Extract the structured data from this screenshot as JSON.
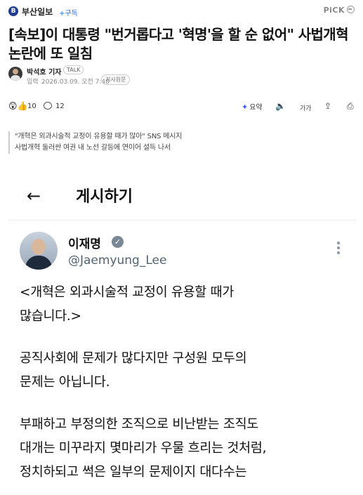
{
  "press": {
    "logo_letter": "B",
    "name": "부산일보",
    "subscribe_label": "+구독",
    "pick_label": "PiCK"
  },
  "article": {
    "headline": "[속보]이 대통령 \"번거롭다고 '혁명'을 할 순 없어\" 사법개혁 논란에 또 일침",
    "author": "박석호 기자",
    "talk_label": "TALK",
    "date_label": "입력",
    "date": "2026.03.09. 오전 7:48",
    "original_label": "기사원문",
    "subtitle_lines": [
      "\"개혁은 외과시술적 교정이 유용할 때가 많아\" SNS 메시지",
      "사법개혁 둘러싼 여권 내 노선 갈등에 연이어 설득 나서"
    ]
  },
  "actions": {
    "reaction_icons": "😲👍",
    "reaction_count": "10",
    "comment_count": "12",
    "summary_label": "요약",
    "audio_icon": "🔈",
    "font_label": "가가",
    "share_icon": "⇪",
    "print_icon": "⎙",
    "summary_icon": "✦"
  },
  "embed": {
    "back_icon": "←",
    "title": "게시하기",
    "tweet": {
      "name": "이재명",
      "verified_icon": "✓",
      "handle": "@Jaemyung_Lee",
      "body_lines": [
        "<개혁은 외과시술적 교정이 유용할 때가",
        "많습니다.>",
        "",
        "공직사회에 문제가 많다지만 구성원 모두의",
        "문제는 아닙니다.",
        "",
        "부패하고 부정의한 조직으로 비난받는 조직도",
        "대개는 미꾸라지 몇마리가 우물 흐리는 것처럼,",
        "정치하되고 썩은 일부의 문제이지 대다수는"
      ]
    }
  }
}
